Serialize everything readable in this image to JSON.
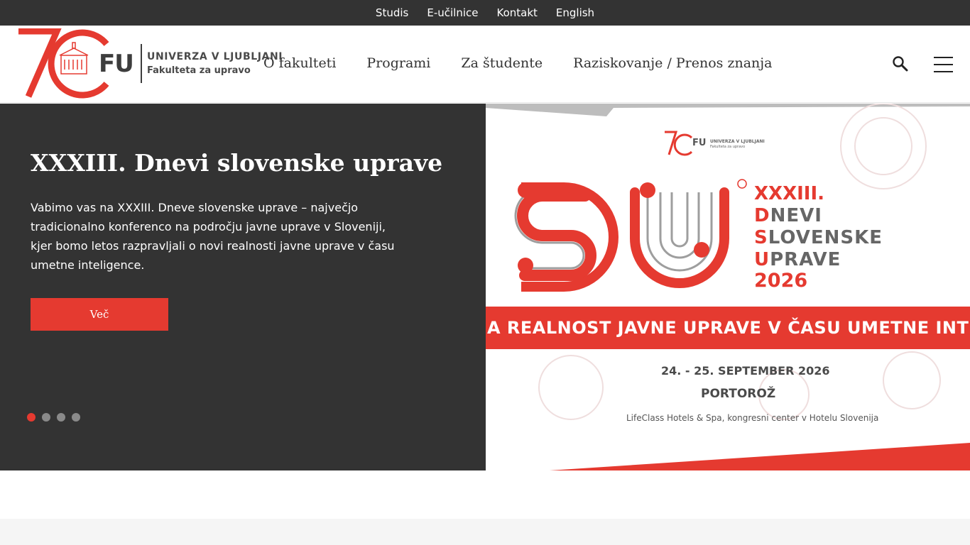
{
  "topbar": {
    "links": [
      "Studis",
      "E-učilnice",
      "Kontakt",
      "English"
    ]
  },
  "header": {
    "logo": {
      "anniversary_mark": "70",
      "short_name": "FU",
      "university": "UNIVERZA V LJUBLJANI",
      "faculty": "Fakulteta za upravo"
    },
    "nav": [
      "O fakulteti",
      "Programi",
      "Za študente",
      "Raziskovanje / Prenos znanja"
    ],
    "icons": {
      "search": "search-icon",
      "menu": "hamburger-menu-icon"
    }
  },
  "hero": {
    "title": "XXXIII. Dnevi slovenske uprave",
    "text": "Vabimo vas na XXXIII. Dneve slovenske uprave – največjo tradicionalno konferenco na področju javne uprave v Sloveniji, kjer bomo letos razpravljali o novi realnosti javne uprave v času umetne inteligence.",
    "button_label": "Več",
    "slides_total": 4,
    "active_slide": 1
  },
  "poster": {
    "logo_fu": "FU",
    "logo_university": "UNIVERZA V LJUBLJANI",
    "logo_faculty": "Fakulteta za upravo",
    "edition": "XXXIII.",
    "lines": [
      {
        "first": "D",
        "rest": "NEVI"
      },
      {
        "first": "S",
        "rest": "LOVENSKE"
      },
      {
        "first": "U",
        "rest": "PRAVE"
      }
    ],
    "year": "2026",
    "banner": "A REALNOST JAVNE UPRAVE V ČASU UMETNE INTELIG",
    "dates": "24. - 25. SEPTEMBER 2026",
    "place": "PORTOROŽ",
    "venue": "LifeClass Hotels & Spa, kongresni center v Hotelu Slovenija"
  },
  "colors": {
    "brand_red": "#e53a30",
    "dark": "#333333",
    "white": "#ffffff"
  }
}
